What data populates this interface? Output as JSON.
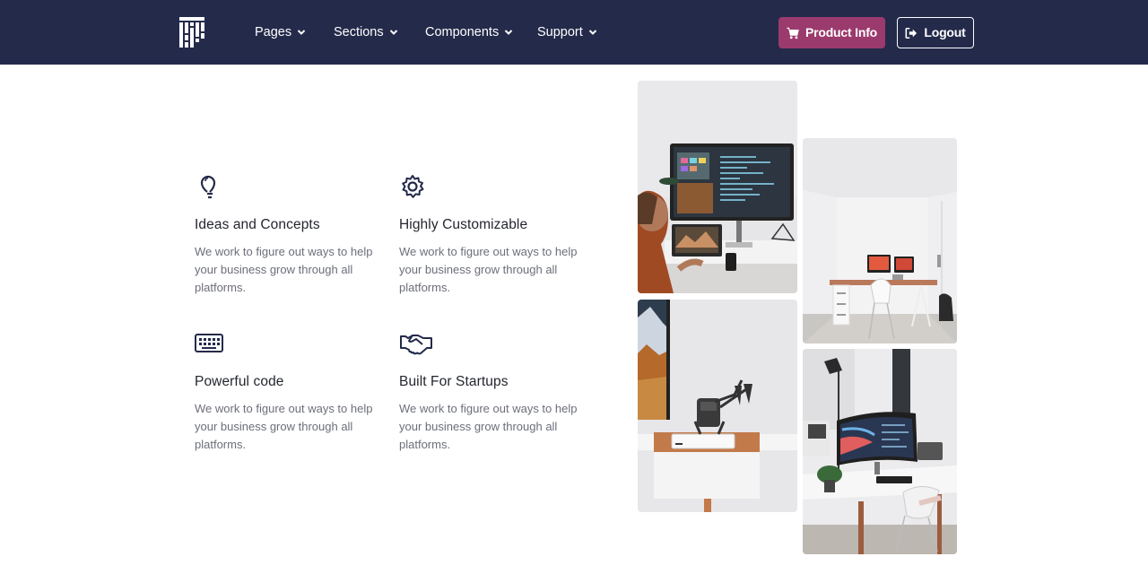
{
  "nav": {
    "items": [
      {
        "label": "Pages"
      },
      {
        "label": "Sections"
      },
      {
        "label": "Components"
      },
      {
        "label": "Support"
      }
    ],
    "product_button": "Product Info",
    "logout_button": "Logout"
  },
  "features": [
    {
      "icon": "lightbulb-icon",
      "title": "Ideas and Concepts",
      "description": "We work to figure out ways to help your business grow through all platforms."
    },
    {
      "icon": "gear-icon",
      "title": "Highly Customizable",
      "description": "We work to figure out ways to help your business grow through all platforms."
    },
    {
      "icon": "keyboard-icon",
      "title": "Powerful code",
      "description": "We work to figure out ways to help your business grow through all platforms."
    },
    {
      "icon": "handshake-icon",
      "title": "Built For Startups",
      "description": "We work to figure out ways to help your business grow through all platforms."
    }
  ],
  "colors": {
    "navbar": "#242a4a",
    "accent": "#9b3a6d",
    "heading": "#24262f",
    "body_text": "#6c6f7a"
  }
}
